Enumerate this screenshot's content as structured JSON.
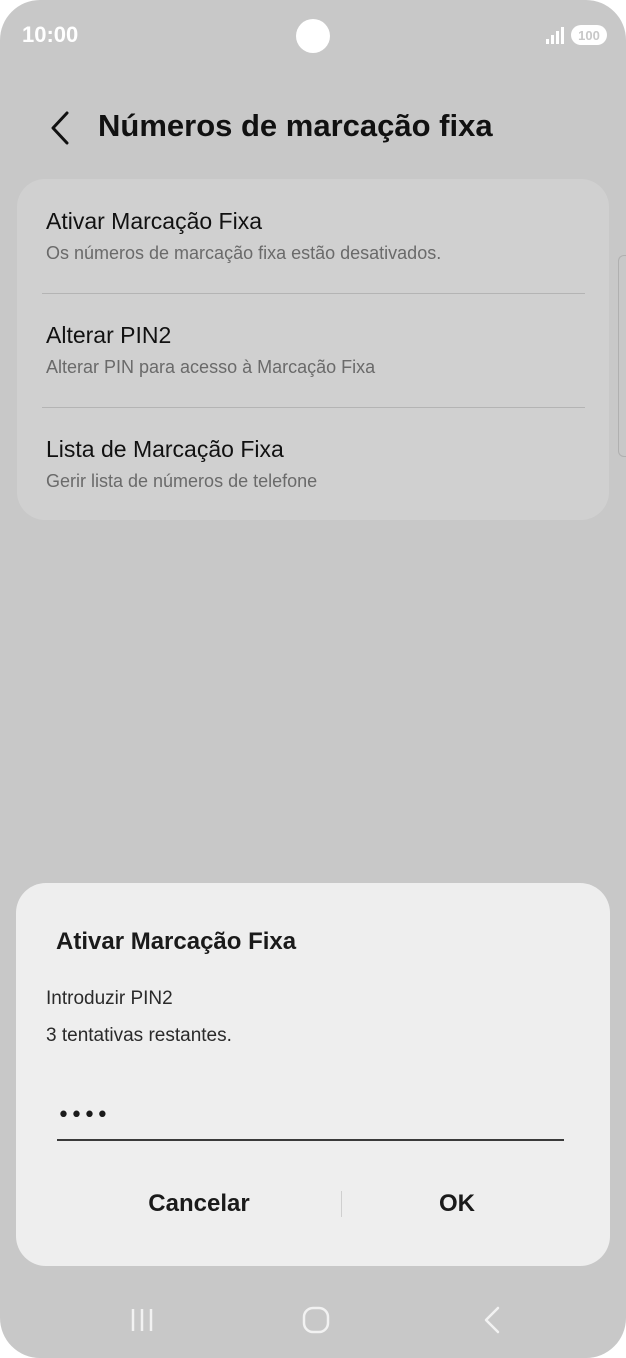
{
  "status_bar": {
    "time": "10:00",
    "battery": "100"
  },
  "header": {
    "title": "Números de marcação fixa"
  },
  "settings": {
    "items": [
      {
        "title": "Ativar Marcação Fixa",
        "subtitle": "Os números de marcação fixa estão desativados."
      },
      {
        "title": "Alterar PIN2",
        "subtitle": "Alterar PIN para acesso à Marcação Fixa"
      },
      {
        "title": "Lista de Marcação Fixa",
        "subtitle": "Gerir lista de números de telefone"
      }
    ]
  },
  "dialog": {
    "title": "Ativar Marcação Fixa",
    "prompt": "Introduzir PIN2",
    "attempts": "3 tentativas restantes.",
    "pin_value": "••••",
    "cancel_label": "Cancelar",
    "ok_label": "OK"
  },
  "colors": {
    "screen_background": "#c8c8c8",
    "card_background": "#d0d0d0",
    "dialog_background": "#eeeeee",
    "text_primary": "#111111",
    "text_secondary": "#6a6a6a"
  },
  "icons": {
    "back": "chevron-left-icon",
    "signal": "signal-icon",
    "battery": "battery-icon",
    "nav_recents": "recents-icon",
    "nav_home": "home-icon",
    "nav_back": "back-icon"
  }
}
